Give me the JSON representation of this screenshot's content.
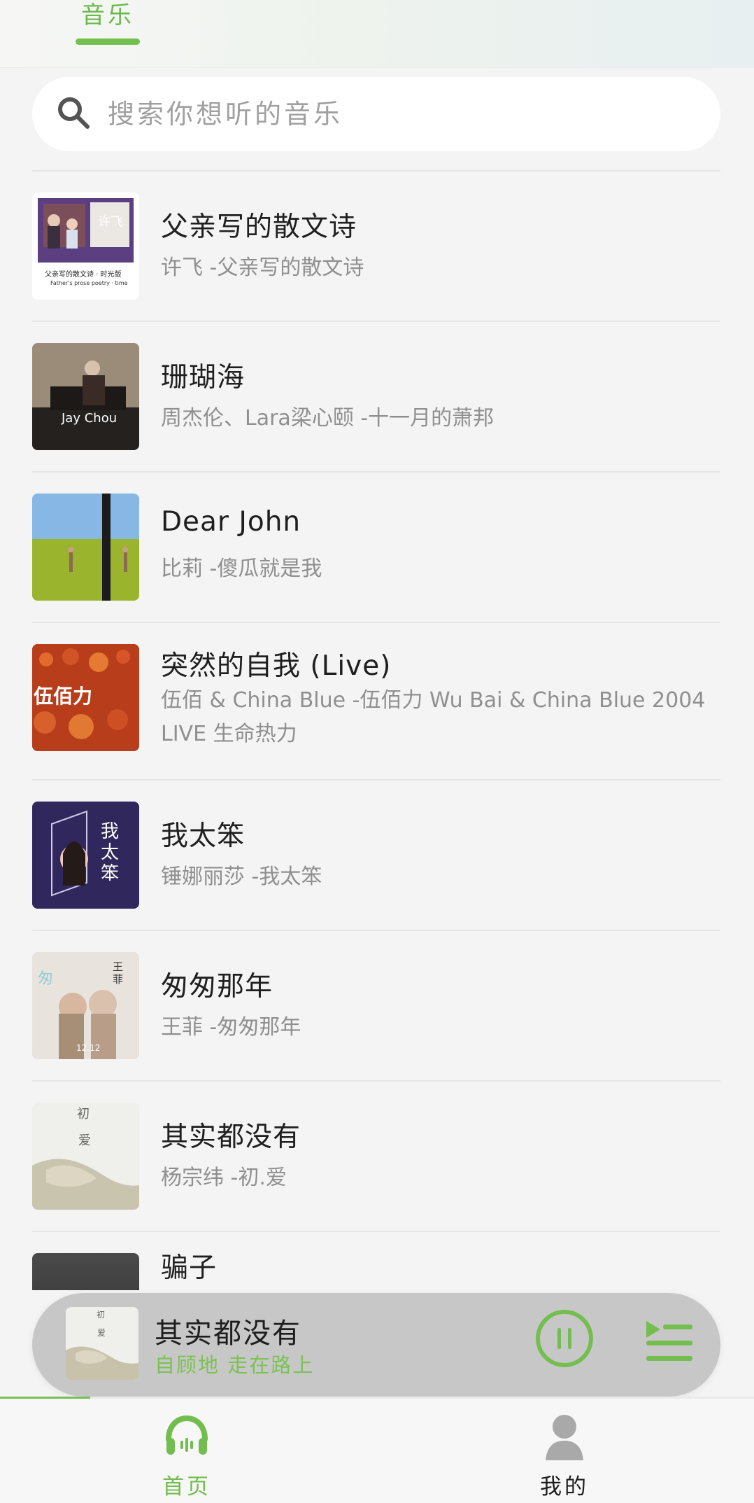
{
  "header": {
    "tab_label": "音乐",
    "active_color": "#73bf4f"
  },
  "search": {
    "placeholder": "搜索你想听的音乐"
  },
  "songs": [
    {
      "title": "父亲写的散文诗",
      "subtitle": "许飞 -父亲写的散文诗",
      "cover_text_1": "许飞",
      "cover_text_2": "父亲写的散文诗 · 时光版",
      "cover_text_3": "Father's prose poetry · time"
    },
    {
      "title": "珊瑚海",
      "subtitle": "周杰伦、Lara梁心颐 -十一月的萧邦",
      "cover_text_1": "Jay Chou"
    },
    {
      "title": "Dear John",
      "subtitle": "比莉 -傻瓜就是我"
    },
    {
      "title": "突然的自我 (Live)",
      "subtitle": "伍佰 & China Blue -伍佰力 Wu Bai & China Blue 2004 LIVE 生命热力",
      "cover_text_1": "伍佰力"
    },
    {
      "title": "我太笨",
      "subtitle": "锤娜丽莎 -我太笨",
      "cover_text_1": "我太笨"
    },
    {
      "title": "匆匆那年",
      "subtitle": "王菲 -匆匆那年",
      "cover_text_1": "王菲",
      "cover_text_2": "12.12"
    },
    {
      "title": "其实都没有",
      "subtitle": "杨宗纬 -初.爱",
      "cover_text_1": "初",
      "cover_text_2": "爱"
    },
    {
      "title": "骗子",
      "subtitle": ""
    }
  ],
  "player": {
    "title": "其实都没有",
    "subtitle": "自顾地 走在路上",
    "cover_text_1": "初",
    "cover_text_2": "爱",
    "progress": 0.12
  },
  "bottom_nav": {
    "home_label": "首页",
    "mine_label": "我的"
  },
  "icons": {
    "search": "search-icon",
    "pause": "pause-icon",
    "playlist": "playlist-icon",
    "home": "headphones-icon",
    "mine": "user-icon"
  }
}
